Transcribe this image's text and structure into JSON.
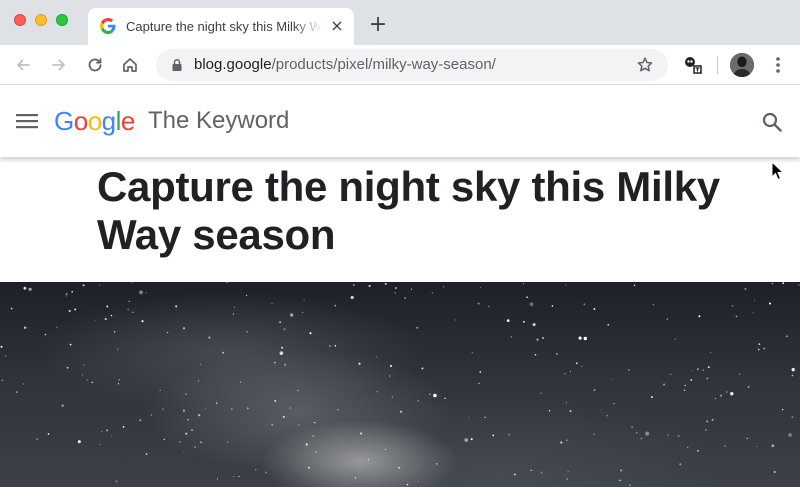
{
  "browser": {
    "tab": {
      "title": "Capture the night sky this Milky Way season",
      "close_glyph": "×"
    },
    "new_tab_glyph": "+",
    "address": {
      "host": "blog.google",
      "path": "/products/pixel/milky-way-season/"
    },
    "icons": {
      "back": "back-arrow-icon",
      "forward": "forward-arrow-icon",
      "reload": "reload-icon",
      "home": "home-icon",
      "lock": "lock-icon",
      "star": "bookmark-star-icon",
      "extension": "translate-extension-icon",
      "profile": "profile-avatar",
      "menu": "kebab-menu-icon"
    }
  },
  "site": {
    "logo_letters": [
      {
        "ch": "G",
        "color": "#4285F4"
      },
      {
        "ch": "o",
        "color": "#EA4335"
      },
      {
        "ch": "o",
        "color": "#FBBC05"
      },
      {
        "ch": "g",
        "color": "#4285F4"
      },
      {
        "ch": "l",
        "color": "#34A853"
      },
      {
        "ch": "e",
        "color": "#EA4335"
      }
    ],
    "section_name": "The Keyword"
  },
  "article": {
    "title": "Capture the night sky this Milky Way season"
  }
}
